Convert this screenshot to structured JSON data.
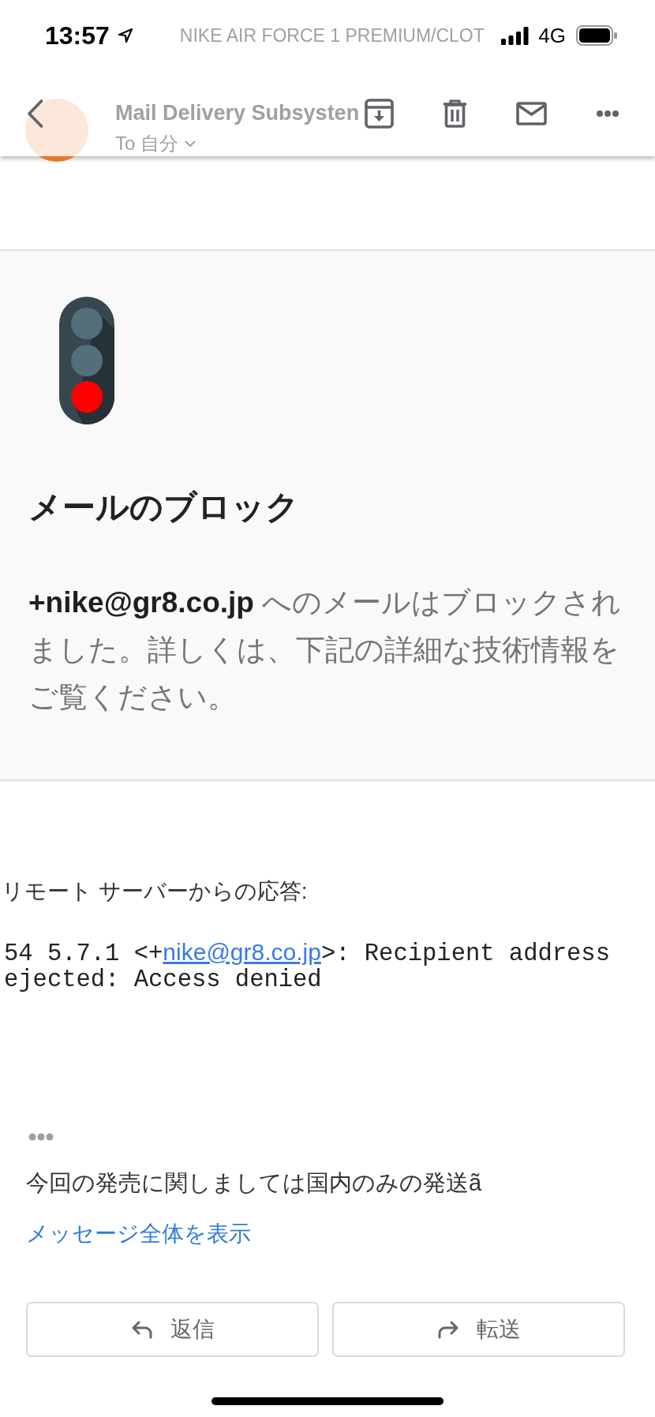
{
  "status_bar": {
    "time": "13:57",
    "network": "4G"
  },
  "message_header": {
    "subject": "NIKE AIR FORCE 1 PREMIUM/CLOT",
    "sender": "Mail Delivery Subsysten",
    "recipient": "To 自分"
  },
  "block_notice": {
    "title": "メールのブロック",
    "message": "**+nike@gr8.co.jp** へのメールはブロックされました。詳しくは、下記の詳細な技術情報をご覧ください。"
  },
  "server_response": {
    "heading": "リモート サーバーからの応答:",
    "lines": [
      [
        {
          "kind": "code",
          "text": "54 5.7.1 <+"
        },
        {
          "kind": "link",
          "text": "nike@gr8.co.jp"
        },
        {
          "kind": "code",
          "text": ">: Recipient address"
        }
      ],
      [
        {
          "kind": "code",
          "text": "ejected: Access denied"
        }
      ]
    ]
  },
  "trimmed_content": {
    "preview": "今回の発売に関しましては国内のみの発送ã",
    "show_full_message": "メッセージ全体を表示"
  },
  "actions": [
    {
      "kind": "reply",
      "label": "返信"
    },
    {
      "kind": "forward",
      "label": "転送"
    }
  ]
}
